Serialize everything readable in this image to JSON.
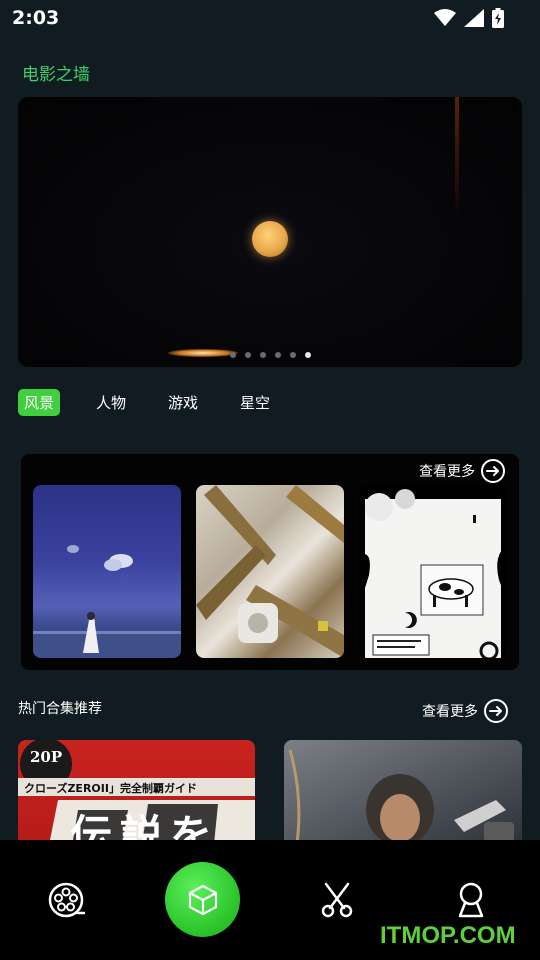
{
  "status": {
    "time": "2:03"
  },
  "app": {
    "title": "电影之墙"
  },
  "banner": {
    "dot_count": 6,
    "active_dot": 5
  },
  "tabs": [
    {
      "label": "风景",
      "active": true
    },
    {
      "label": "人物",
      "active": false
    },
    {
      "label": "游戏",
      "active": false
    },
    {
      "label": "星空",
      "active": false
    }
  ],
  "scenery": {
    "more_label": "查看更多"
  },
  "hot": {
    "title": "热门合集推荐",
    "more_label": "查看更多"
  },
  "collections": [
    {
      "line1": "20P",
      "line2": "クローズZEROII」完全制覇ガイド",
      "line3": "伝説を"
    },
    {
      "line1": ""
    }
  ],
  "icons": {
    "nav": [
      "film-reel-icon",
      "cube-icon",
      "scissors-icon",
      "profile-icon"
    ],
    "status": [
      "wifi-icon",
      "signal-icon",
      "battery-icon"
    ]
  },
  "colors": {
    "accent": "#3fcf3f",
    "title_green": "#3fcf6a",
    "background": "#111c22"
  },
  "watermark": "ITMOP.COM"
}
